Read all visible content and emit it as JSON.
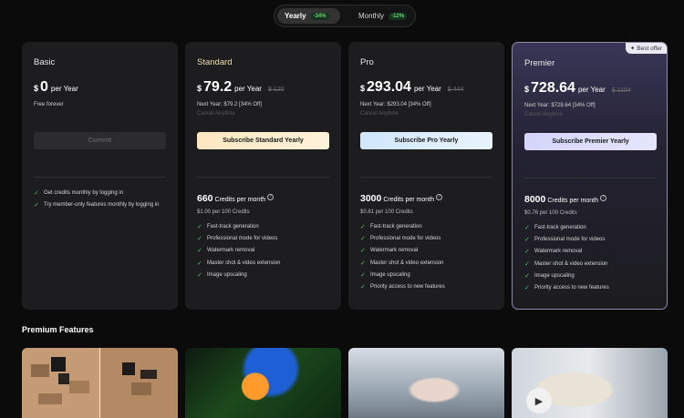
{
  "toggle": {
    "yearly": {
      "label": "Yearly",
      "discount": "-34%"
    },
    "monthly": {
      "label": "Monthly",
      "discount": "-12%"
    }
  },
  "plans": [
    {
      "name": "Basic",
      "currency": "$",
      "price": "0",
      "period": "per Year",
      "original": "",
      "line1": "Free forever",
      "line2": "",
      "button": "Current",
      "credits": "",
      "credits_label": "",
      "per100": "",
      "features": [
        "Get credits monthly by logging in",
        "Try member-only features monthly by logging in"
      ]
    },
    {
      "name": "Standard",
      "currency": "$",
      "price": "79.2",
      "period": "per Year",
      "original": "$ 120",
      "line1": "Next Year: $79.2 [34% Off]",
      "line2": "Cancel Anytime",
      "button": "Subscribe Standard Yearly",
      "credits": "660",
      "credits_label": "Credits per month",
      "per100": "$1.00 per 100 Credits",
      "features": [
        "Fast-track generation",
        "Professional mode for videos",
        "Watermark removal",
        "Master shot & video extension",
        "Image upscaling"
      ]
    },
    {
      "name": "Pro",
      "currency": "$",
      "price": "293.04",
      "period": "per Year",
      "original": "$ 444",
      "line1": "Next Year: $293.04 [34% Off]",
      "line2": "Cancel Anytime",
      "button": "Subscribe Pro Yearly",
      "credits": "3000",
      "credits_label": "Credits per month",
      "per100": "$0.81 per 100 Credits",
      "features": [
        "Fast-track generation",
        "Professional mode for videos",
        "Watermark removal",
        "Master shot & video extension",
        "Image upscaling",
        "Priority access to new features"
      ]
    },
    {
      "name": "Premier",
      "currency": "$",
      "price": "728.64",
      "period": "per Year",
      "original": "$ 1104",
      "line1": "Next Year: $728.64 [34% Off]",
      "line2": "Cancel Anytime",
      "button": "Subscribe Premier Yearly",
      "credits": "8000",
      "credits_label": "Credits per month",
      "per100": "$0.76 per 100 Credits",
      "features": [
        "Fast-track generation",
        "Professional mode for videos",
        "Watermark removal",
        "Master shot & video extension",
        "Image upscaling",
        "Priority access to new features"
      ],
      "badge": "Best offer"
    }
  ],
  "section": {
    "title": "Premium Features"
  },
  "icons": {
    "check": "check-icon",
    "help": "question-icon",
    "sparkle": "sparkle-icon",
    "play": "play-icon"
  }
}
